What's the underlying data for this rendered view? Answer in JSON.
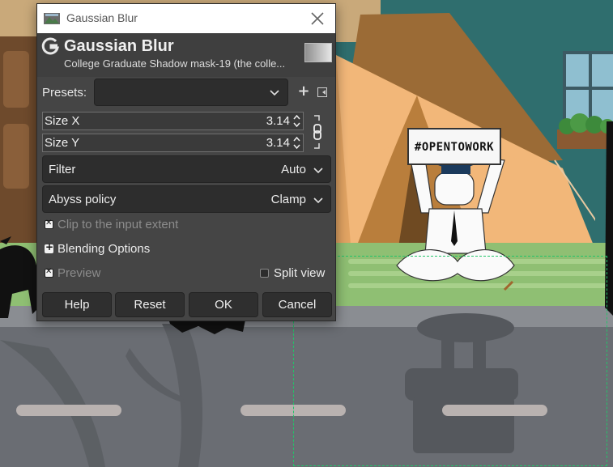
{
  "dialog": {
    "window_title": "Gaussian Blur",
    "header_title": "Gaussian Blur",
    "header_subtitle": "College Graduate Shadow mask-19 (the colle...",
    "presets_label": "Presets:",
    "presets_value": "",
    "size_x_label": "Size X",
    "size_x_value": "3.14",
    "size_y_label": "Size Y",
    "size_y_value": "3.14",
    "filter_label": "Filter",
    "filter_value": "Auto",
    "abyss_label": "Abyss policy",
    "abyss_value": "Clamp",
    "clip_label": "Clip to the input extent",
    "blending_label": "Blending Options",
    "preview_label": "Preview",
    "split_label": "Split view",
    "buttons": {
      "help": "Help",
      "reset": "Reset",
      "ok": "OK",
      "cancel": "Cancel"
    },
    "icons": {
      "app": "gimp-app-icon",
      "close": "close-icon",
      "logo": "gimp-logo-icon",
      "add": "plus-icon",
      "menu": "preset-menu-icon",
      "chain": "chain-link-icon",
      "chevron": "chevron-down-icon",
      "spin": "spin-arrows-icon"
    }
  },
  "canvas": {
    "sign_text": "#OPENTOWORK"
  },
  "colors": {
    "dialog_bg": "#454545",
    "field_bg": "#2d2d2d",
    "selection": "#22c46a",
    "wall": "#2f6e6e"
  }
}
